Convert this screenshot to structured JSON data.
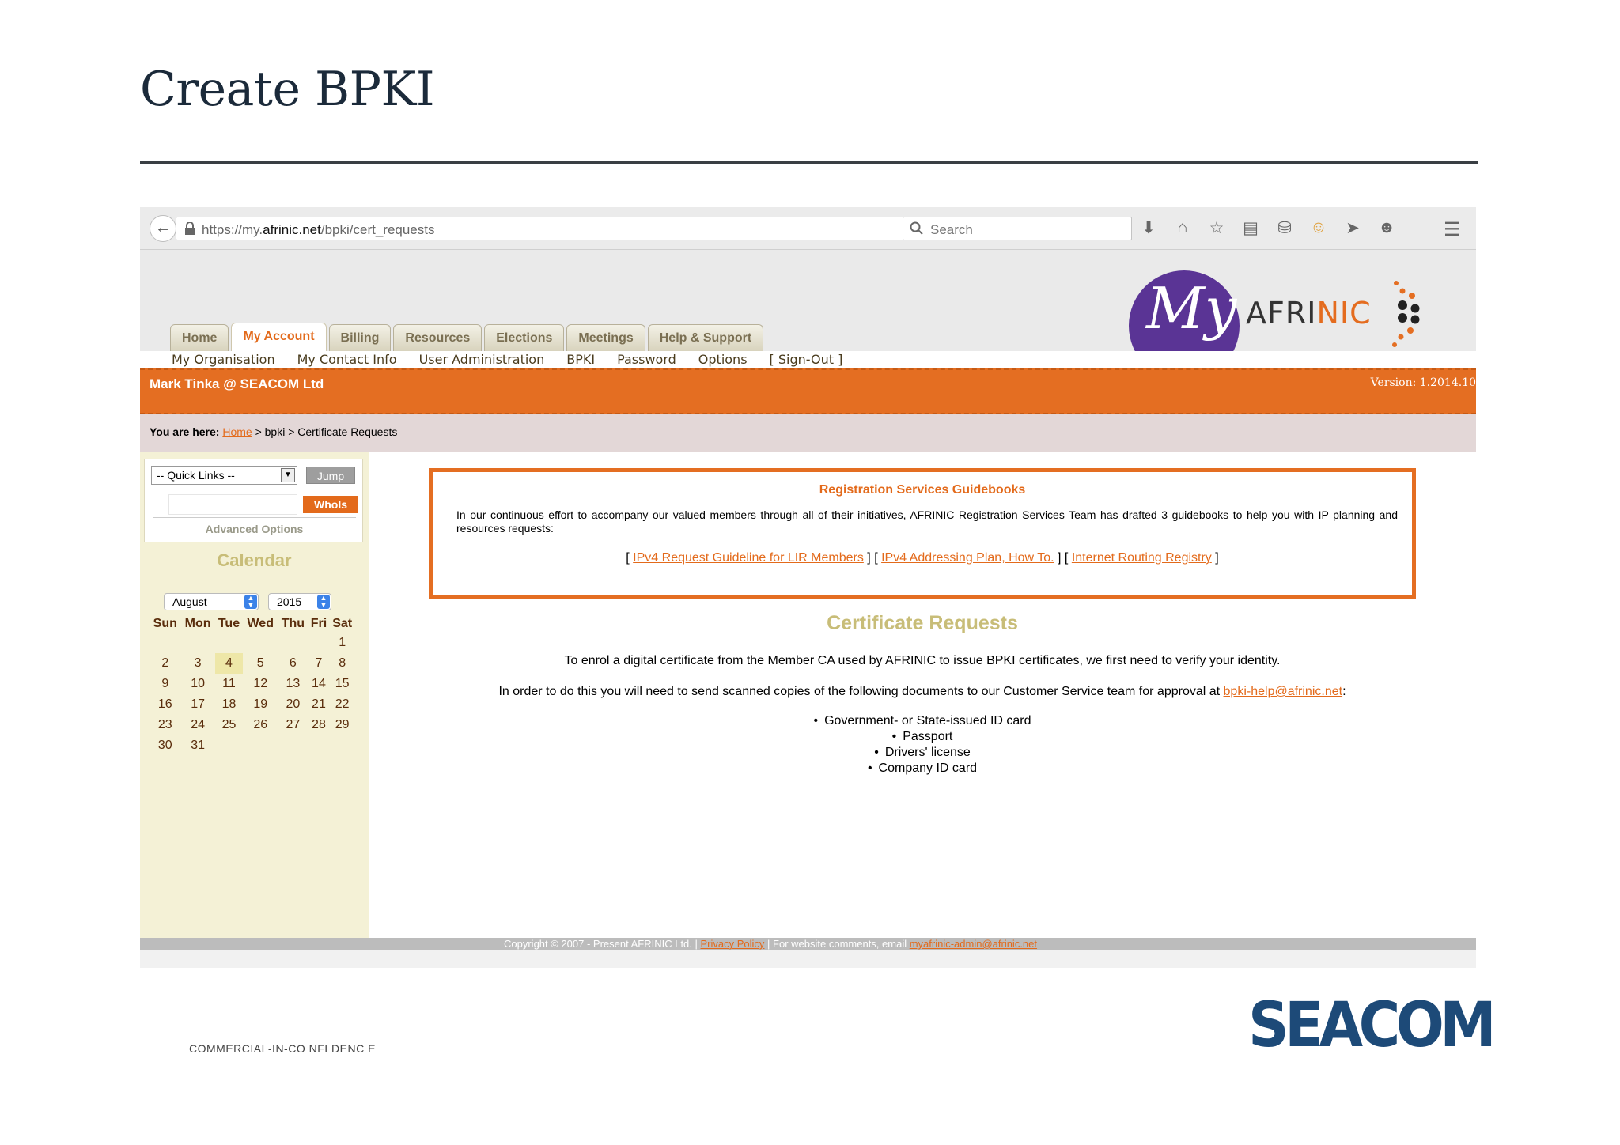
{
  "slide": {
    "title": "Create BPKI",
    "footer": "COMMERCIAL-IN-CO NFI DENC E",
    "logo_text": "SEACOM"
  },
  "browser": {
    "url_prefix": "https://my.",
    "url_domain": "afrinic.net",
    "url_path": "/bpki/cert_requests",
    "search_placeholder": "Search"
  },
  "site": {
    "logo_my": "My",
    "logo_afri": "AFRI",
    "logo_nic": "NIC",
    "main_tabs": [
      "Home",
      "My Account",
      "Billing",
      "Resources",
      "Elections",
      "Meetings",
      "Help & Support"
    ],
    "active_tab": "My Account",
    "sub_nav": [
      "My Organisation",
      "My Contact Info",
      "User Administration",
      "BPKI",
      "Password",
      "Options",
      "[ Sign-Out ]"
    ],
    "user": "Mark Tinka @ SEACOM Ltd",
    "version": "Version: 1.2014.10",
    "breadcrumb": {
      "label": "You are here:",
      "home": "Home",
      "rest": " > bpki > Certificate Requests"
    }
  },
  "sidebar": {
    "quick_links": "-- Quick Links --",
    "jump": "Jump",
    "whois": "WhoIs",
    "advanced": "Advanced Options",
    "calendar_title": "Calendar",
    "month": "August",
    "year": "2015",
    "weekdays": [
      "Sun",
      "Mon",
      "Tue",
      "Wed",
      "Thu",
      "Fri",
      "Sat"
    ],
    "weeks": [
      [
        "",
        "",
        "",
        "",
        "",
        "",
        "1"
      ],
      [
        "2",
        "3",
        "4",
        "5",
        "6",
        "7",
        "8"
      ],
      [
        "9",
        "10",
        "11",
        "12",
        "13",
        "14",
        "15"
      ],
      [
        "16",
        "17",
        "18",
        "19",
        "20",
        "21",
        "22"
      ],
      [
        "23",
        "24",
        "25",
        "26",
        "27",
        "28",
        "29"
      ],
      [
        "30",
        "31",
        "",
        "",
        "",
        "",
        ""
      ]
    ],
    "today": "4"
  },
  "guide": {
    "title": "Registration Services Guidebooks",
    "text": "In our continuous effort to accompany our valued members through all of their initiatives, AFRINIC Registration Services Team has drafted 3 guidebooks to help you with IP planning and resources requests:",
    "links": [
      "IPv4 Request Guideline for LIR Members",
      "IPv4 Addressing Plan, How To.",
      "Internet Routing Registry"
    ]
  },
  "cert": {
    "title": "Certificate Requests",
    "p1": "To enrol a digital certificate from the Member CA used by AFRINIC to issue BPKI certificates, we first need to verify your identity.",
    "p2_text": "In order to do this you will need to send scanned copies of the following documents to our Customer Service team for approval at ",
    "p2_email": "bpki-help@afrinic.net",
    "p2_end": ":",
    "documents": [
      "Government- or State-issued ID card",
      "Passport",
      "Drivers' license",
      "Company ID card"
    ]
  },
  "footer": {
    "copyright": "Copyright © 2007 - Present AFRINIC Ltd. | ",
    "privacy": "Privacy Policy",
    "comments": " | For website comments, email ",
    "email": "myafrinic-admin@afrinic.net"
  },
  "colors": {
    "accent": "#e46e22",
    "calendar_bg": "#f4f1d6",
    "heading_khaki": "#c8bd78"
  }
}
